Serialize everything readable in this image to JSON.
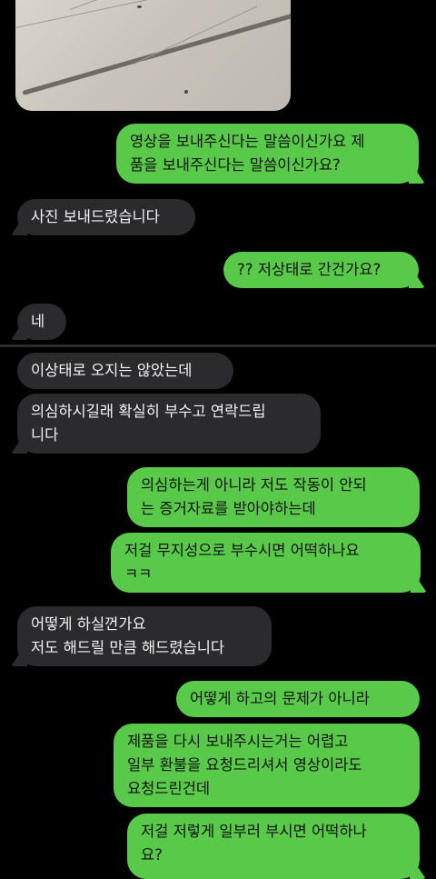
{
  "conversation": {
    "photo": {
      "icon": "photo-attachment"
    },
    "messages": [
      {
        "side": "sent",
        "lines": [
          "영상을 보내주신다는 말씀이신가요 제",
          "품을 보내주신다는 말씀이신가요?"
        ]
      },
      {
        "side": "received",
        "lines": [
          "사진 보내드렸습니다"
        ]
      },
      {
        "side": "sent",
        "lines": [
          "?? 저상태로 간건가요?"
        ]
      },
      {
        "side": "received",
        "lines": [
          "네"
        ]
      },
      {
        "side": "received",
        "lines": [
          "이상태로 오지는 않았는데"
        ]
      },
      {
        "side": "received",
        "lines": [
          "의심하시길래 확실히 부수고 연락드립",
          "니다"
        ]
      },
      {
        "side": "sent",
        "lines": [
          "의심하는게 아니라 저도 작동이 안되",
          "는 증거자료를 받아야하는데"
        ]
      },
      {
        "side": "sent",
        "lines": [
          "저걸 무지성으로 부수시면 어떡하나요",
          "ㅋㅋ"
        ]
      },
      {
        "side": "received",
        "lines": [
          "어떻게 하실껀가요",
          "저도 해드릴 만큼 해드렸습니다"
        ]
      },
      {
        "side": "sent",
        "lines": [
          "어떻게 하고의 문제가 아니라"
        ]
      },
      {
        "side": "sent",
        "lines": [
          "제품을 다시 보내주시는거는 어렵고",
          "일부 환불을 요청드리셔서 영상이라도",
          "요청드린건데"
        ]
      },
      {
        "side": "sent",
        "lines": [
          "저걸 저렇게 일부러 부시면 어떡하나",
          "요?"
        ]
      }
    ]
  },
  "theme": {
    "background": "#000000",
    "sent_bubble": "#59c94a",
    "received_bubble": "#2b2b2d"
  }
}
